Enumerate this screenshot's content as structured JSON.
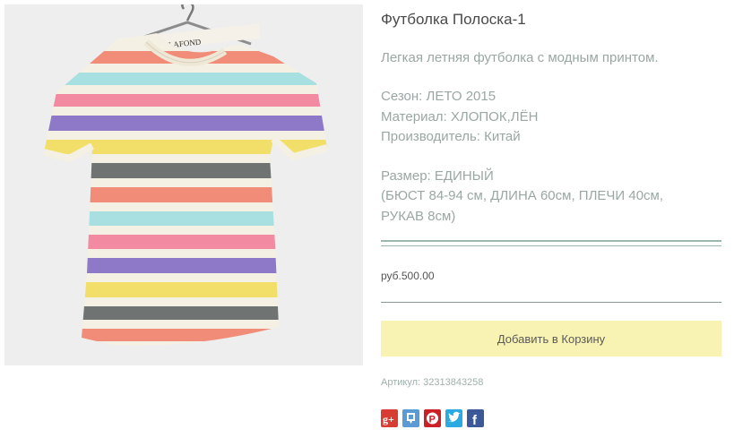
{
  "product": {
    "title": "Футболка Полоска-1",
    "description": "Легкая летняя футболка с модным принтом.",
    "season": "Сезон: ЛЕТО 2015",
    "material": "Материал: ХЛОПОК,ЛЁН",
    "manufacturer": "Производитель: Китай",
    "size": "Размер: ЕДИНЫЙ",
    "dimensions_line1": "(БЮСТ 84-94 см, ДЛИНА 60см, ПЛЕЧИ 40см,",
    "dimensions_line2": "РУКАВ 8см)",
    "price": "руб.500.00",
    "add_to_cart_label": "Добавить в Корзину",
    "sku": "Артикул: 32313843258",
    "image_label_text": "BERNARD LAFOND"
  },
  "share": [
    {
      "icon": "google-plus-icon",
      "color": "#d73d32",
      "glyph": "g+"
    },
    {
      "icon": "odnoklassniki-icon",
      "color": "#5b9bd5",
      "glyph": "ok"
    },
    {
      "icon": "pinterest-icon",
      "color": "#cb2027",
      "glyph": "P"
    },
    {
      "icon": "twitter-icon",
      "color": "#2ba9e1",
      "glyph": "t"
    },
    {
      "icon": "facebook-icon",
      "color": "#3b5998",
      "glyph": "f"
    }
  ],
  "colors": {
    "title": "#4a4a4a",
    "muted_text": "#9aa7a3",
    "rule": "#9bb7b0",
    "button_bg": "#f9f3b3"
  }
}
